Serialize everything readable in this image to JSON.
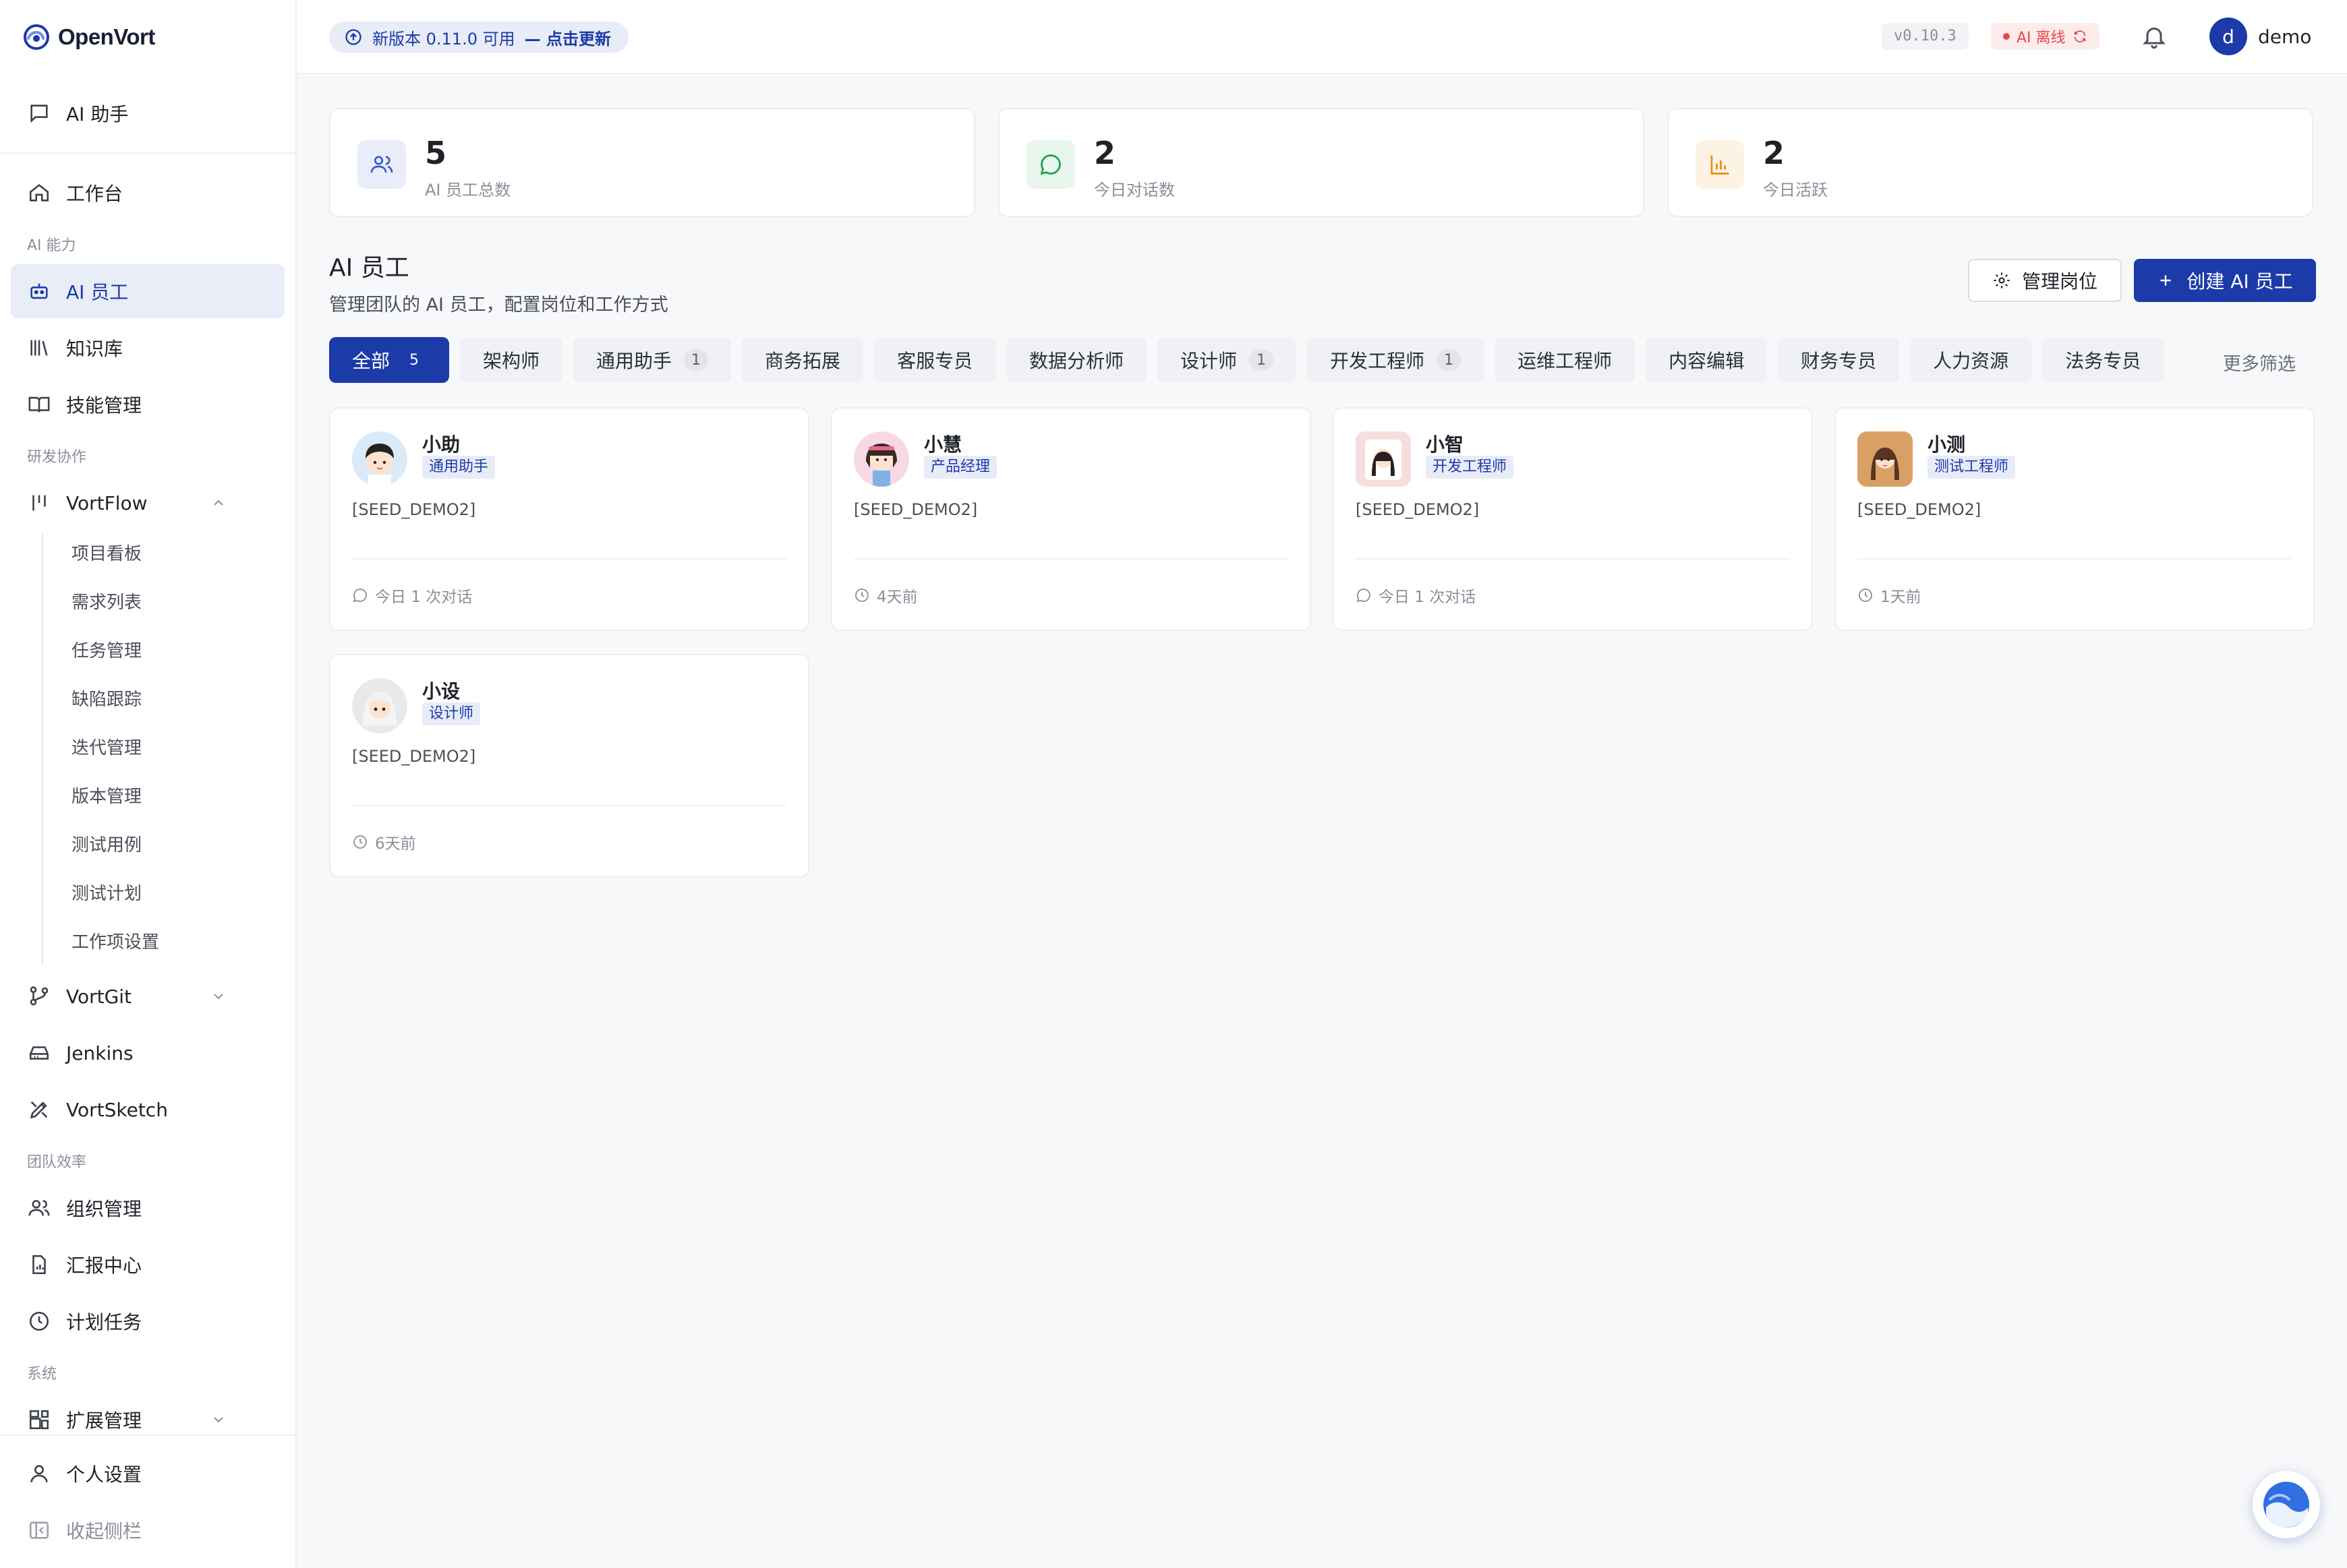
{
  "brand": {
    "name": "OpenVort"
  },
  "sidebar": {
    "ai_assistant": "AI 助手",
    "workbench": "工作台",
    "group_ai": "AI 能力",
    "ai_employees": "AI 员工",
    "knowledge": "知识库",
    "skills": "技能管理",
    "group_dev": "研发协作",
    "vortflow": "VortFlow",
    "vortflow_sub": [
      "项目看板",
      "需求列表",
      "任务管理",
      "缺陷跟踪",
      "迭代管理",
      "版本管理",
      "测试用例",
      "测试计划",
      "工作项设置"
    ],
    "vortgit": "VortGit",
    "jenkins": "Jenkins",
    "vortsketch": "VortSketch",
    "group_team": "团队效率",
    "org": "组织管理",
    "reports": "汇报中心",
    "scheduled": "计划任务",
    "group_system": "系统",
    "extensions": "扩展管理",
    "personal": "个人设置",
    "collapse": "收起侧栏"
  },
  "topbar": {
    "update_text": "新版本 0.11.0 可用",
    "update_link": "— 点击更新",
    "version": "v0.10.3",
    "ai_status": "AI 离线",
    "user_initial": "d",
    "user_name": "demo"
  },
  "stats": [
    {
      "value": "5",
      "label": "AI 员工总数",
      "icon": "users-icon",
      "color": "#3b5bcc"
    },
    {
      "value": "2",
      "label": "今日对话数",
      "icon": "chat-icon",
      "color": "#16a34a"
    },
    {
      "value": "2",
      "label": "今日活跃",
      "icon": "bar-chart-icon",
      "color": "#ea8a0c"
    }
  ],
  "section": {
    "title": "AI 员工",
    "subtitle": "管理团队的 AI 员工，配置岗位和工作方式",
    "manage_btn": "管理岗位",
    "create_btn": "创建 AI 员工"
  },
  "filters": [
    {
      "label": "全部",
      "count": "5"
    },
    {
      "label": "架构师",
      "count": ""
    },
    {
      "label": "通用助手",
      "count": "1"
    },
    {
      "label": "商务拓展",
      "count": ""
    },
    {
      "label": "客服专员",
      "count": ""
    },
    {
      "label": "数据分析师",
      "count": ""
    },
    {
      "label": "设计师",
      "count": "1"
    },
    {
      "label": "开发工程师",
      "count": "1"
    },
    {
      "label": "运维工程师",
      "count": ""
    },
    {
      "label": "内容编辑",
      "count": ""
    },
    {
      "label": "财务专员",
      "count": ""
    },
    {
      "label": "人力资源",
      "count": ""
    },
    {
      "label": "法务专员",
      "count": ""
    }
  ],
  "more_filter": "更多筛选",
  "employees": [
    {
      "name": "小助",
      "role": "通用助手",
      "desc": "[SEED_DEMO2]",
      "meta": "今日 1 次对话",
      "meta_icon": "chat-icon"
    },
    {
      "name": "小慧",
      "role": "产品经理",
      "desc": "[SEED_DEMO2]",
      "meta": "4天前",
      "meta_icon": "clock-icon"
    },
    {
      "name": "小智",
      "role": "开发工程师",
      "desc": "[SEED_DEMO2]",
      "meta": "今日 1 次对话",
      "meta_icon": "chat-icon"
    },
    {
      "name": "小测",
      "role": "测试工程师",
      "desc": "[SEED_DEMO2]",
      "meta": "1天前",
      "meta_icon": "clock-icon"
    },
    {
      "name": "小设",
      "role": "设计师",
      "desc": "[SEED_DEMO2]",
      "meta": "6天前",
      "meta_icon": "clock-icon"
    }
  ],
  "colors": {
    "accent": "#1c3ba8",
    "danger": "#e5484d"
  }
}
